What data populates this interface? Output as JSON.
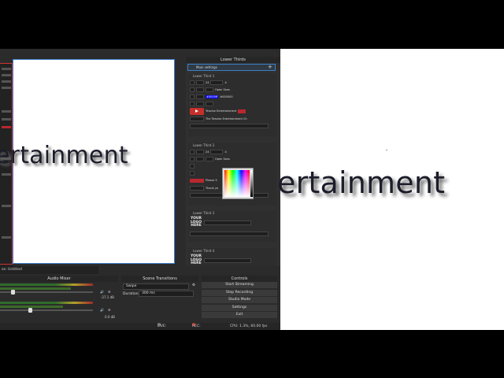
{
  "preview": {
    "text": "ertainment"
  },
  "output": {
    "text": "ertainment"
  },
  "lower_thirds": {
    "title": "Lower Thirds",
    "main_settings": "Main settings",
    "items": [
      {
        "title": "Lower Third 1",
        "size": "24",
        "anim": "4",
        "font": "Open Sans",
        "hex1": "#0000ff",
        "hex2": "#000000",
        "line1": "Teavise Entertainment",
        "line2": "The Teavise Entertainment Ch"
      },
      {
        "title": "Lower Third 2",
        "size": "24",
        "anim": "4",
        "font": "Open Sans",
        "line1": "Please S",
        "line2": "Thank yo"
      },
      {
        "title": "Lower Third 3",
        "logo": "YOUR LOGO HERE"
      },
      {
        "title": "Lower Third 4",
        "logo": "YOUR LOGO HERE"
      }
    ]
  },
  "scene_bar": {
    "label": "es: Untitled"
  },
  "audio_mixer": {
    "title": "Audio Mixer",
    "track1_db": "-27.1 dB",
    "track2_db": "0.0 dB"
  },
  "scene_transitions": {
    "title": "Scene Transitions",
    "transition": "Swipe",
    "duration_label": "Duration",
    "duration_value": "300 ms"
  },
  "controls": {
    "title": "Controls",
    "buttons": [
      "Start Streaming",
      "Stop Recording",
      "Studio Mode",
      "Settings",
      "Exit"
    ]
  },
  "status": {
    "live": "LIVE: 00:00:00",
    "rec": "REC: 00:04:48",
    "cpu": "CPU: 1.3%, 60.00 fps"
  },
  "colors": {
    "panel": "#2b2b2b",
    "accent": "#3d7ec9",
    "rec": "#c4302b"
  }
}
